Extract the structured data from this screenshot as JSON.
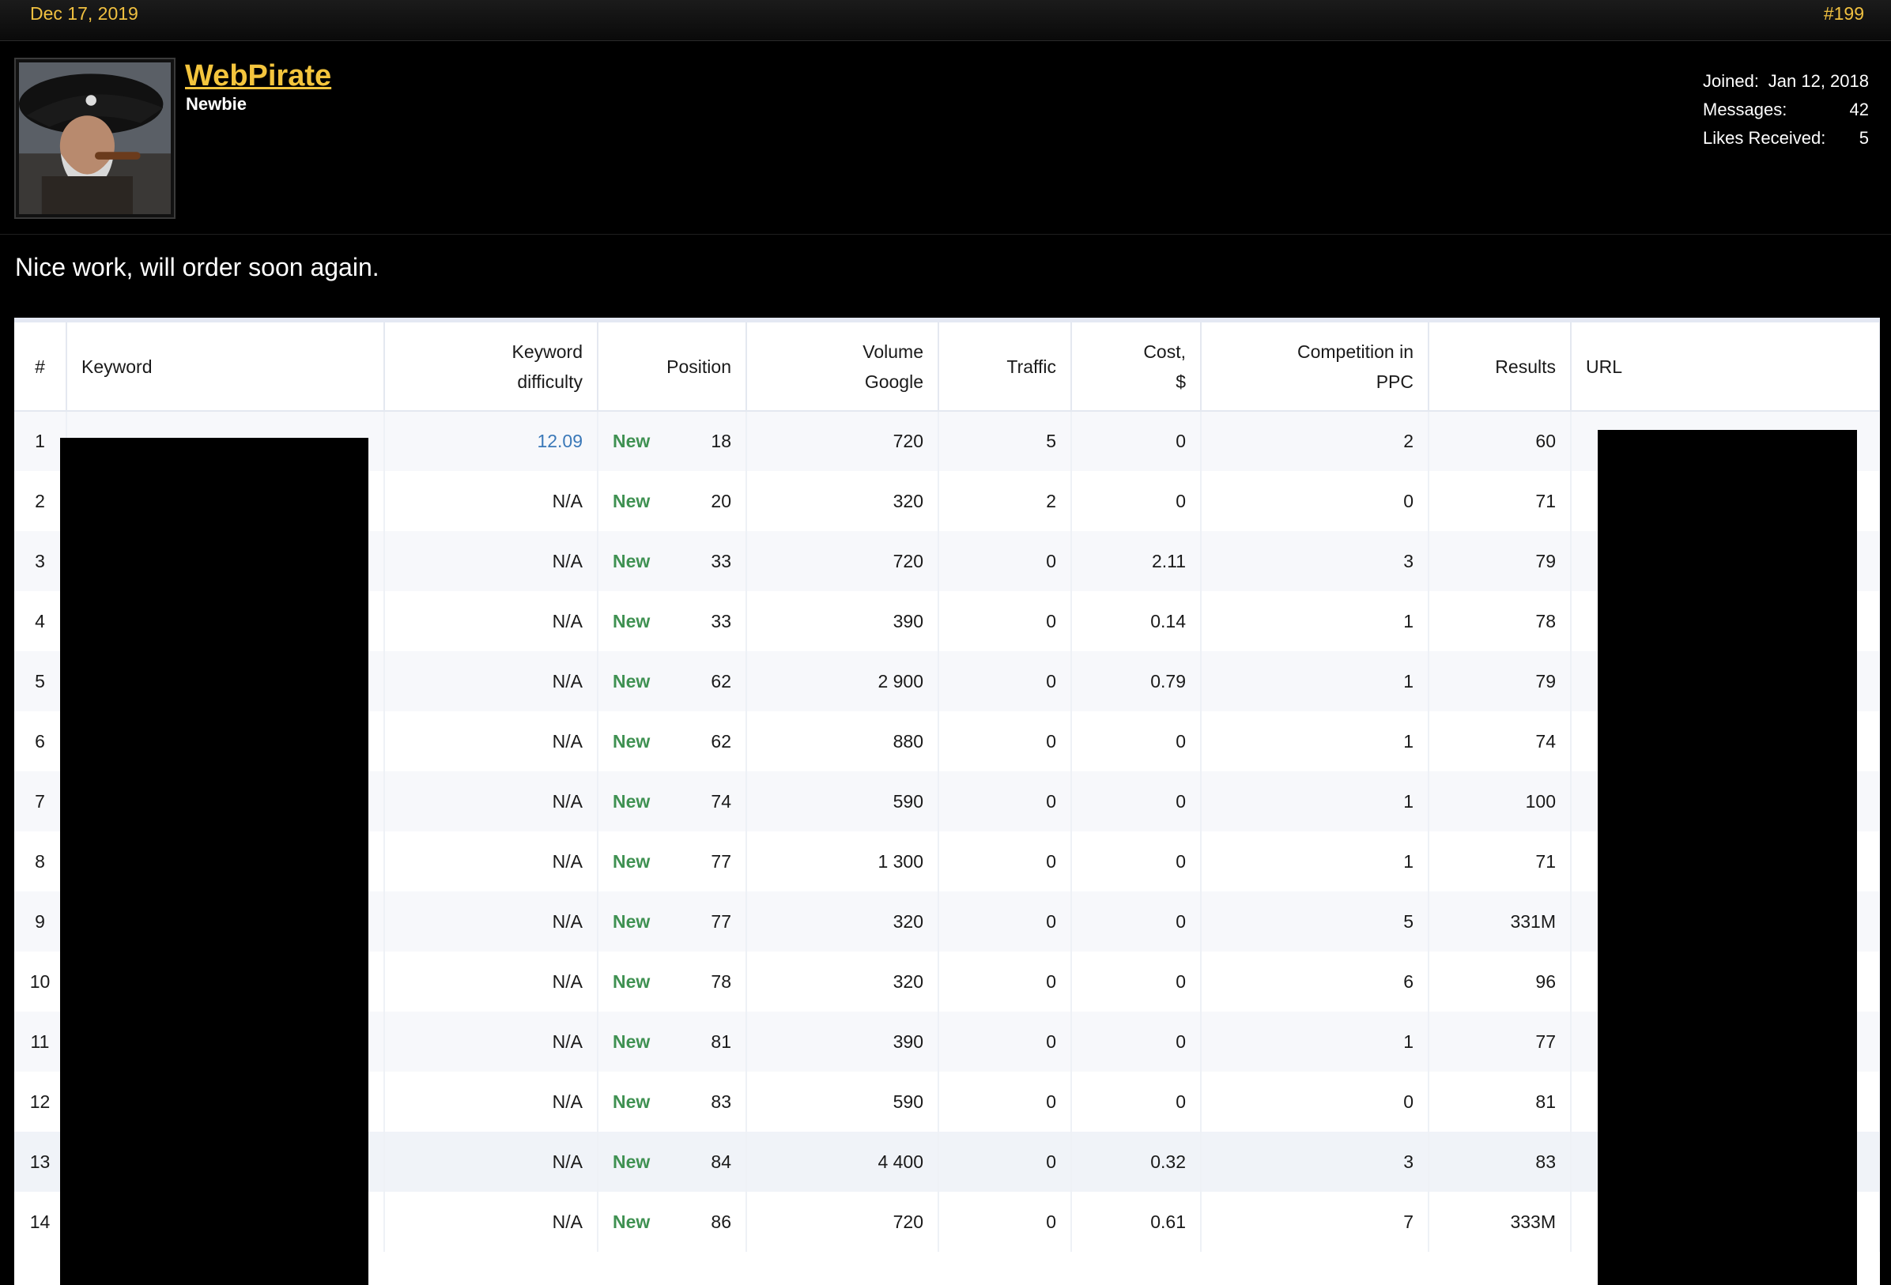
{
  "post": {
    "date": "Dec 17, 2019",
    "number": "#199",
    "message": "Nice work, will order soon again."
  },
  "user": {
    "name": "WebPirate",
    "title": "Newbie",
    "joined_label": "Joined:",
    "joined_value": "Jan 12, 2018",
    "messages_label": "Messages:",
    "messages_value": "42",
    "likes_label": "Likes Received:",
    "likes_value": "5",
    "avatar_icon": "pirate-avatar-icon"
  },
  "table": {
    "headers": {
      "idx": "#",
      "keyword": "Keyword",
      "kd_line1": "Keyword",
      "kd_line2": "difficulty",
      "position": "Position",
      "volume_line1": "Volume",
      "volume_line2": "Google",
      "traffic": "Traffic",
      "cost_line1": "Cost,",
      "cost_line2": "$",
      "comp_line1": "Competition in",
      "comp_line2": "PPC",
      "results": "Results",
      "url": "URL"
    },
    "rows": [
      {
        "idx": "1",
        "kd": "12.09",
        "badge": "New",
        "position": "18",
        "volume": "720",
        "traffic": "5",
        "cost": "0",
        "competition": "2",
        "results": "60"
      },
      {
        "idx": "2",
        "kd": "N/A",
        "badge": "New",
        "position": "20",
        "volume": "320",
        "traffic": "2",
        "cost": "0",
        "competition": "0",
        "results": "71"
      },
      {
        "idx": "3",
        "kd": "N/A",
        "badge": "New",
        "position": "33",
        "volume": "720",
        "traffic": "0",
        "cost": "2.11",
        "competition": "3",
        "results": "79"
      },
      {
        "idx": "4",
        "kd": "N/A",
        "badge": "New",
        "position": "33",
        "volume": "390",
        "traffic": "0",
        "cost": "0.14",
        "competition": "1",
        "results": "78"
      },
      {
        "idx": "5",
        "kd": "N/A",
        "badge": "New",
        "position": "62",
        "volume": "2 900",
        "traffic": "0",
        "cost": "0.79",
        "competition": "1",
        "results": "79"
      },
      {
        "idx": "6",
        "kd": "N/A",
        "badge": "New",
        "position": "62",
        "volume": "880",
        "traffic": "0",
        "cost": "0",
        "competition": "1",
        "results": "74"
      },
      {
        "idx": "7",
        "kd": "N/A",
        "badge": "New",
        "position": "74",
        "volume": "590",
        "traffic": "0",
        "cost": "0",
        "competition": "1",
        "results": "100"
      },
      {
        "idx": "8",
        "kd": "N/A",
        "badge": "New",
        "position": "77",
        "volume": "1 300",
        "traffic": "0",
        "cost": "0",
        "competition": "1",
        "results": "71"
      },
      {
        "idx": "9",
        "kd": "N/A",
        "badge": "New",
        "position": "77",
        "volume": "320",
        "traffic": "0",
        "cost": "0",
        "competition": "5",
        "results": "331M"
      },
      {
        "idx": "10",
        "kd": "N/A",
        "badge": "New",
        "position": "78",
        "volume": "320",
        "traffic": "0",
        "cost": "0",
        "competition": "6",
        "results": "96"
      },
      {
        "idx": "11",
        "kd": "N/A",
        "badge": "New",
        "position": "81",
        "volume": "390",
        "traffic": "0",
        "cost": "0",
        "competition": "1",
        "results": "77"
      },
      {
        "idx": "12",
        "kd": "N/A",
        "badge": "New",
        "position": "83",
        "volume": "590",
        "traffic": "0",
        "cost": "0",
        "competition": "0",
        "results": "81"
      },
      {
        "idx": "13",
        "kd": "N/A",
        "badge": "New",
        "position": "84",
        "volume": "4 400",
        "traffic": "0",
        "cost": "0.32",
        "competition": "3",
        "results": "83"
      },
      {
        "idx": "14",
        "kd": "N/A",
        "badge": "New",
        "position": "86",
        "volume": "720",
        "traffic": "0",
        "cost": "0.61",
        "competition": "7",
        "results": "333M"
      }
    ]
  },
  "colors": {
    "accent": "#f4c53d",
    "new_badge": "#3f9152",
    "link": "#3a78b8"
  }
}
